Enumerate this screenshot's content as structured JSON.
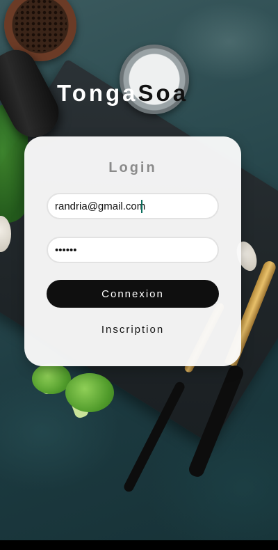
{
  "app": {
    "title_part1": "Tonga",
    "title_part2": "Soa"
  },
  "login": {
    "heading": "Login",
    "email_value": "randria@gmail.com",
    "password_value": "••••••",
    "submit_label": "Connexion",
    "register_label": "Inscription"
  },
  "colors": {
    "primary_button": "#0f0f0f",
    "card_background": "#fafafa",
    "heading_gray": "#8a8a8a",
    "cursor_teal": "#0a6d5c"
  }
}
